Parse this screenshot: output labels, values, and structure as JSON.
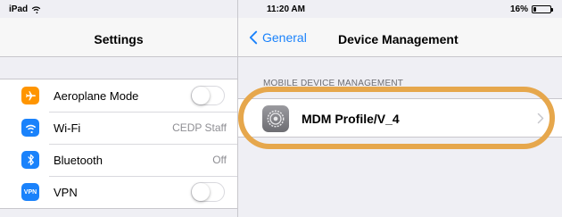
{
  "status_bar": {
    "device": "iPad",
    "wifi_icon": "wifi-icon",
    "time": "11:20 AM",
    "battery_percent": "16%",
    "battery_level": 0.16
  },
  "settings_pane": {
    "title": "Settings",
    "items": [
      {
        "label": "Aeroplane Mode",
        "icon": "airplane-icon",
        "icon_color": "#ff9500",
        "control": "toggle",
        "on": false
      },
      {
        "label": "Wi-Fi",
        "icon": "wifi-icon",
        "icon_color": "#1a82fb",
        "value": "CEDP Staff"
      },
      {
        "label": "Bluetooth",
        "icon": "bluetooth-icon",
        "icon_color": "#1a82fb",
        "value": "Off"
      },
      {
        "label": "VPN",
        "icon": "vpn-icon",
        "icon_text": "VPN",
        "icon_color": "#1a82fb",
        "control": "toggle",
        "on": false
      }
    ]
  },
  "detail_pane": {
    "back_label": "General",
    "title": "Device Management",
    "section_header": "MOBILE DEVICE MANAGEMENT",
    "profile": {
      "label": "MDM Profile/V_4",
      "icon": "gear-icon"
    }
  },
  "colors": {
    "accent": "#1a82fb",
    "highlight": "#e6a74c",
    "background": "#efeff4"
  }
}
